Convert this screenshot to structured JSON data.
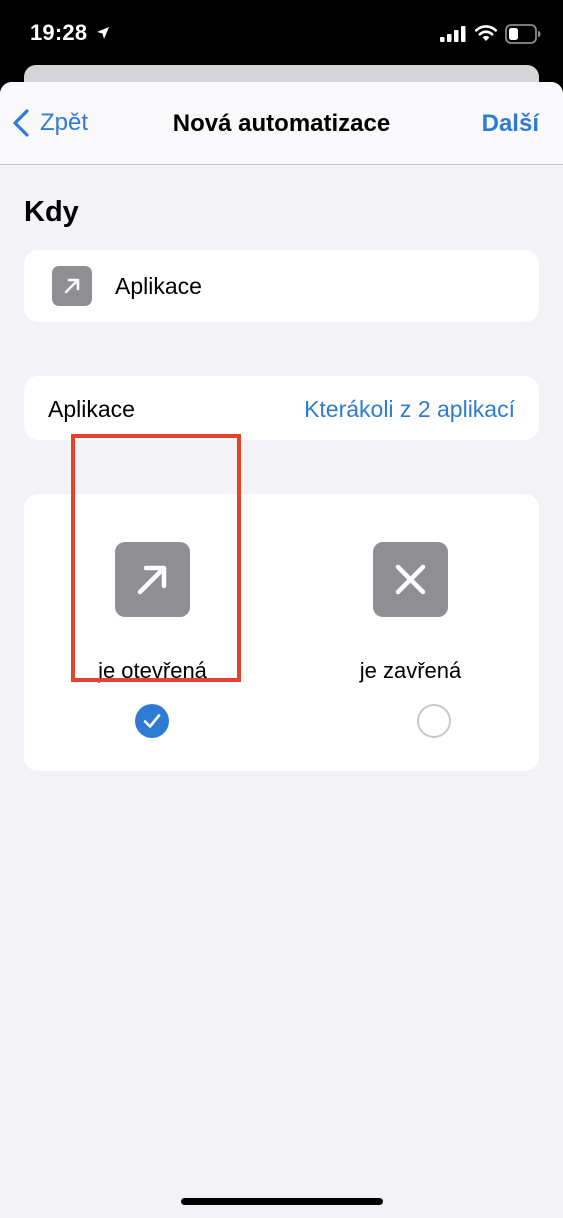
{
  "status_bar": {
    "time": "19:28"
  },
  "nav": {
    "back_label": "Zpět",
    "title": "Nová automatizace",
    "next_label": "Další"
  },
  "section": {
    "heading": "Kdy"
  },
  "trigger": {
    "label": "Aplikace",
    "icon": "arrow-up-right-icon"
  },
  "apps_row": {
    "label": "Aplikace",
    "value": "Kterákoli z 2 aplikací"
  },
  "options": [
    {
      "label": "je otevřená",
      "icon": "arrow-up-right-icon",
      "selected": true
    },
    {
      "label": "je zavřená",
      "icon": "x-mark-icon",
      "selected": false
    }
  ],
  "colors": {
    "accent": "#2f7bd4",
    "highlight": "#e8412c",
    "icon_bg": "#8e8e93",
    "background": "#f2f2f7"
  }
}
